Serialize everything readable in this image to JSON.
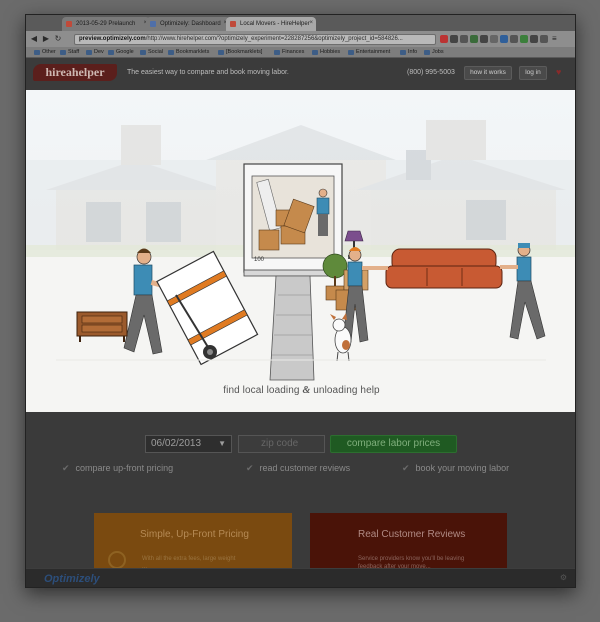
{
  "browser": {
    "tabs": [
      {
        "label": "2013-05-29 Prelaunch",
        "active": false
      },
      {
        "label": "Optimizely: Dashboard",
        "active": false
      },
      {
        "label": "Local Movers - HireHelper",
        "active": true
      }
    ],
    "url_host": "preview.optimizely.com",
    "url_rest": "/http://www.hirehelper.com/?optimizely_experiment=228287256&optimizely_project_id=584826...",
    "bookmarks": [
      "Other",
      "Staff",
      "Dev",
      "Google",
      "Social",
      "Bookmarklets",
      "[Bookmarklets]",
      "Finances",
      "Hobbies",
      "Entertainment",
      "Info",
      "Jobs"
    ]
  },
  "header": {
    "logo": "hireahelper",
    "tagline": "The easiest way to compare and book moving labor.",
    "phone": "(800) 995-5003",
    "how_it_works": "how it works",
    "log_in": "log in"
  },
  "hero": {
    "caption_prefix": "find local loading",
    "caption_amp": "&",
    "caption_suffix": "unloading help"
  },
  "form": {
    "date_value": "06/02/2013",
    "zip_placeholder": "zip code",
    "cta_label": "compare labor prices"
  },
  "benefits": [
    "compare up-front pricing",
    "read customer reviews",
    "book your moving labor"
  ],
  "cards": {
    "pricing": {
      "title": "Simple, Up-Front Pricing",
      "body_line1": "With all the extra fees, large weight",
      "body_line2": "..."
    },
    "reviews": {
      "title": "Real Customer Reviews",
      "body_line1": "Service providers know you'll be leaving",
      "body_line2": "feedback after your move..."
    }
  },
  "optimizely": {
    "brand": "Optimizely"
  },
  "colors": {
    "brand": "#5b1f1c",
    "cta_green": "#1f5a22",
    "mover_shirt": "#3d8cb5",
    "couch": "#c85a33",
    "dolly_strap": "#e07b22"
  }
}
